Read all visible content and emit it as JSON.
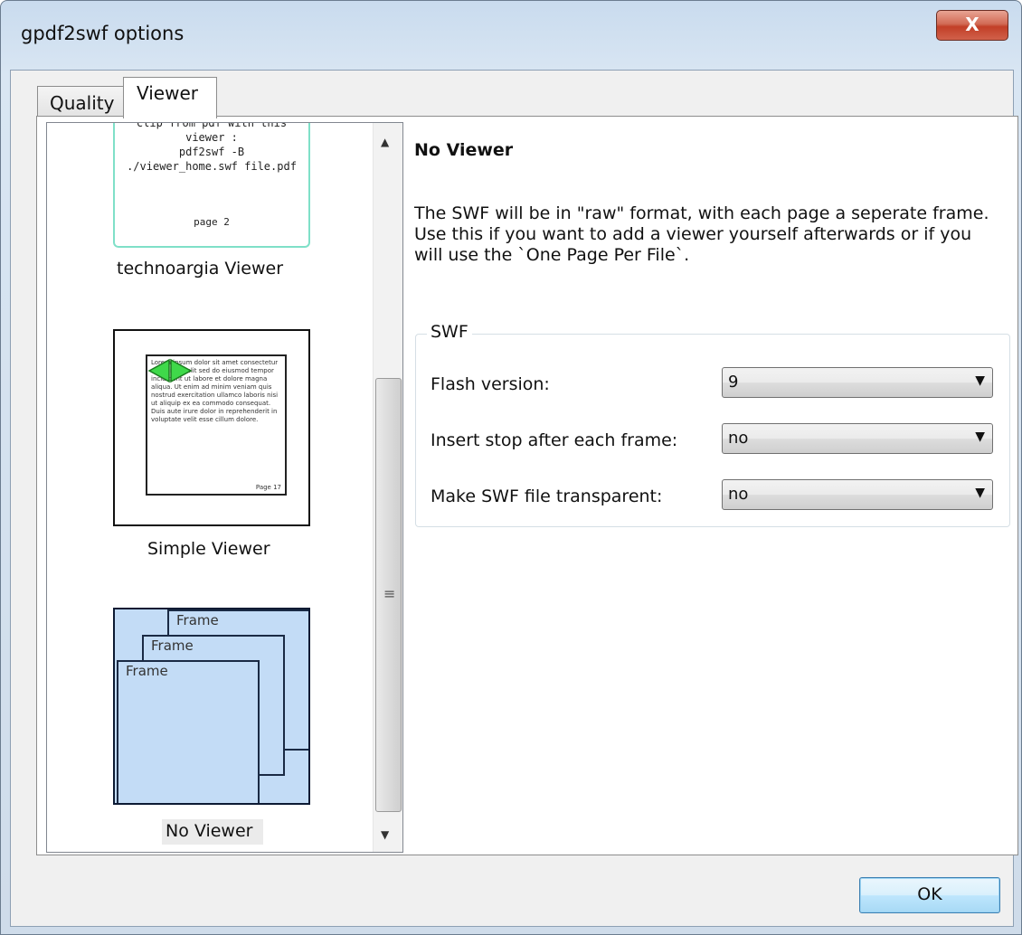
{
  "window": {
    "title": "gpdf2swf options",
    "close_label": "X"
  },
  "tabs": [
    {
      "label": "Quality",
      "selected": false
    },
    {
      "label": "Viewer",
      "selected": true
    }
  ],
  "viewers": [
    {
      "label": "technoargia Viewer",
      "thumb_lines": [
        "clip from pdf with this",
        "viewer :",
        "pdf2swf -B",
        "./viewer_home.swf file.pdf"
      ],
      "thumb_page": "page 2"
    },
    {
      "label": "Simple Viewer",
      "thumb_text": "Lorem ipsum dolor sit amet consectetur adipisicing elit sed do eiusmod tempor incididunt ut labore et dolore magna aliqua. Ut enim ad minim veniam quis nostrud exercitation ullamco laboris nisi ut aliquip ex ea commodo consequat. Duis aute irure dolor in reprehenderit in voluptate velit esse cillum dolore.",
      "thumb_page": "Page 17"
    },
    {
      "label": "No Viewer",
      "selected": true,
      "frames": [
        "Frame",
        "Frame",
        "Frame"
      ]
    }
  ],
  "detail": {
    "heading": "No Viewer",
    "description": "The SWF will be in \"raw\" format, with each page a seperate frame. Use this if you want to add a viewer yourself afterwards or if you will use the `One Page Per File`."
  },
  "swf_group": {
    "title": "SWF",
    "rows": [
      {
        "label": "Flash version:",
        "value": "9"
      },
      {
        "label": "Insert stop after each frame:",
        "value": "no"
      },
      {
        "label": "Make SWF file transparent:",
        "value": "no"
      }
    ]
  },
  "buttons": {
    "ok": "OK"
  },
  "colors": {
    "accent": "#3c7fb1",
    "close": "#c23f27",
    "frame_fill": "#c3dcf6",
    "selected_thumb_border": "#7fe0c8"
  }
}
